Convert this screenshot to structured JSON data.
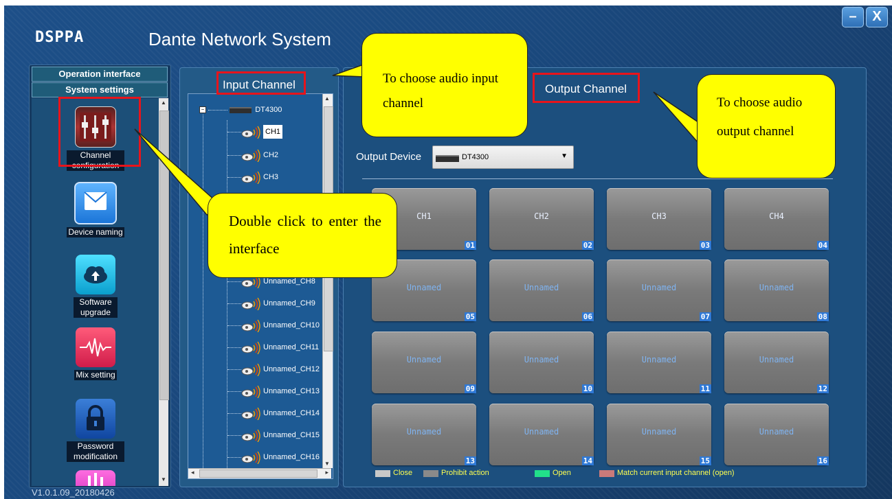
{
  "window": {
    "logo": "DSPPA",
    "title": "Dante Network System",
    "minimize": "–",
    "close": "X",
    "version": "V1.0.1.09_20180426"
  },
  "sidebar": {
    "headers": [
      "Operation interface",
      "System settings"
    ],
    "items": [
      {
        "label": "Channel configuration",
        "icon": "channel-config-icon"
      },
      {
        "label": "Device naming",
        "icon": "device-naming-icon"
      },
      {
        "label": "Software upgrade",
        "icon": "cloud-upload-icon"
      },
      {
        "label": "Mix setting",
        "icon": "waveform-icon"
      },
      {
        "label": "Password modification",
        "icon": "lock-icon"
      }
    ]
  },
  "input": {
    "title": "Input Channel",
    "device": "DT4300",
    "channels": [
      "CH1",
      "CH2",
      "CH3",
      "Unnamed_CH8",
      "Unnamed_CH9",
      "Unnamed_CH10",
      "Unnamed_CH11",
      "Unnamed_CH12",
      "Unnamed_CH13",
      "Unnamed_CH14",
      "Unnamed_CH15",
      "Unnamed_CH16"
    ]
  },
  "output": {
    "title": "Output Channel",
    "device_label": "Output Device",
    "device_value": "DT4300",
    "channels": [
      {
        "name": "CH1",
        "num": "01"
      },
      {
        "name": "CH2",
        "num": "02"
      },
      {
        "name": "CH3",
        "num": "03"
      },
      {
        "name": "CH4",
        "num": "04"
      },
      {
        "name": "Unnamed",
        "num": "05"
      },
      {
        "name": "Unnamed",
        "num": "06"
      },
      {
        "name": "Unnamed",
        "num": "07"
      },
      {
        "name": "Unnamed",
        "num": "08"
      },
      {
        "name": "Unnamed",
        "num": "09"
      },
      {
        "name": "Unnamed",
        "num": "10"
      },
      {
        "name": "Unnamed",
        "num": "11"
      },
      {
        "name": "Unnamed",
        "num": "12"
      },
      {
        "name": "Unnamed",
        "num": "13"
      },
      {
        "name": "Unnamed",
        "num": "14"
      },
      {
        "name": "Unnamed",
        "num": "15"
      },
      {
        "name": "Unnamed",
        "num": "16"
      }
    ],
    "legend": [
      {
        "label": "Close",
        "color": "#c8c8c8"
      },
      {
        "label": "Prohibit action",
        "color": "#8a8a8a"
      },
      {
        "label": "Open",
        "color": "#22e08a"
      },
      {
        "label": "Match current input channel (open)",
        "color": "#c97a7a"
      }
    ]
  },
  "callouts": {
    "input": "To choose audio input channel",
    "output": "To choose audio output channel",
    "double": "Double click to enter the interface"
  }
}
